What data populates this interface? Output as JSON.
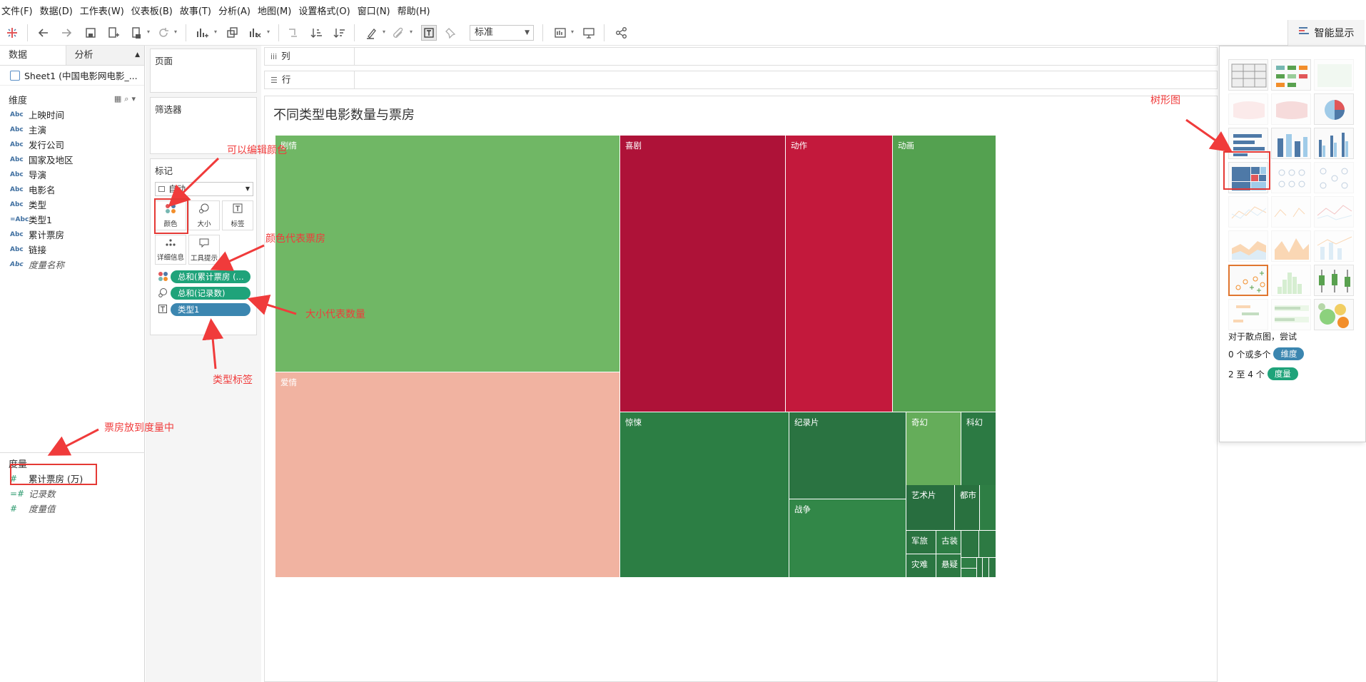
{
  "menubar": {
    "items": [
      "文件(F)",
      "数据(D)",
      "工作表(W)",
      "仪表板(B)",
      "故事(T)",
      "分析(A)",
      "地图(M)",
      "设置格式(O)",
      "窗口(N)",
      "帮助(H)"
    ]
  },
  "toolbar": {
    "fit_value": "标准",
    "show_me_label": "智能显示",
    "icons": [
      "tableau-logo-icon",
      "undo-icon",
      "redo-icon",
      "save-icon",
      "new-datasource-icon",
      "pause-updates-icon",
      "refresh-icon",
      "new-worksheet-icon",
      "duplicate-icon",
      "clear-icon",
      "swap-icon",
      "sort-ascending-icon",
      "sort-descending-icon",
      "highlight-icon",
      "group-icon",
      "show-labels-icon",
      "pin-icon",
      "show-cards-icon",
      "presentation-icon",
      "share-icon"
    ]
  },
  "data_pane": {
    "tab_data": "数据",
    "tab_analysis": "分析",
    "datasource": "Sheet1 (中国电影网电影_...",
    "dimensions_header": "维度",
    "dimensions": [
      {
        "type": "Abc",
        "name": "上映时间"
      },
      {
        "type": "Abc",
        "name": "主演"
      },
      {
        "type": "Abc",
        "name": "发行公司"
      },
      {
        "type": "Abc",
        "name": "国家及地区"
      },
      {
        "type": "Abc",
        "name": "导演"
      },
      {
        "type": "Abc",
        "name": "电影名"
      },
      {
        "type": "Abc",
        "name": "类型"
      },
      {
        "type": "=Abc",
        "name": "类型1"
      },
      {
        "type": "Abc",
        "name": "累计票房"
      },
      {
        "type": "Abc",
        "name": "链接"
      },
      {
        "type": "Abc",
        "name": "度量名称"
      }
    ],
    "measures_header": "度量",
    "measures": [
      {
        "type": "#",
        "name": "累计票房 (万)"
      },
      {
        "type": "=#",
        "name": "记录数"
      },
      {
        "type": "#",
        "name": "度量值"
      }
    ]
  },
  "shelves": {
    "pages_title": "页面",
    "filters_title": "筛选器",
    "marks_title": "标记",
    "marks_type": "自动",
    "mark_buttons": [
      "颜色",
      "大小",
      "标签",
      "详细信息",
      "工具提示"
    ],
    "pills": [
      {
        "label": "总和(累计票房 (...",
        "color": "#1fa37a"
      },
      {
        "label": "总和(记录数)",
        "color": "#1fa37a"
      },
      {
        "label": "类型1",
        "color": "#3b86b0"
      }
    ],
    "columns_label": "列",
    "rows_label": "行"
  },
  "view": {
    "title": "不同类型电影数量与票房"
  },
  "chart_data": {
    "type": "treemap",
    "title": "不同类型电影数量与票房",
    "size_measure": "总和(记录数)",
    "color_measure": "总和(累计票房 (万))",
    "label_dimension": "类型1",
    "tiles": [
      {
        "label": "剧情",
        "color": "#70b765"
      },
      {
        "label": "爱情",
        "color": "#f1b3a1"
      },
      {
        "label": "喜剧",
        "color": "#ae1238"
      },
      {
        "label": "动作",
        "color": "#c3193c"
      },
      {
        "label": "动画",
        "color": "#54a150"
      },
      {
        "label": "惊悚",
        "color": "#2c7e44"
      },
      {
        "label": "纪录片",
        "color": "#2a7341"
      },
      {
        "label": "奇幻",
        "color": "#65ad5a"
      },
      {
        "label": "科幻",
        "color": "#2c7a43"
      },
      {
        "label": "战争",
        "color": "#328748"
      },
      {
        "label": "艺术片",
        "color": "#286e3f"
      },
      {
        "label": "都市",
        "color": "#29713f"
      },
      {
        "label": "",
        "color": "#2e7e44"
      },
      {
        "label": "军旅",
        "color": "#2a7340"
      },
      {
        "label": "古装",
        "color": "#2d7d44"
      },
      {
        "label": "",
        "color": "#2b7541"
      },
      {
        "label": "",
        "color": "#2d7a43"
      },
      {
        "label": "灾难",
        "color": "#2b7642"
      },
      {
        "label": "悬疑",
        "color": "#2c7842"
      },
      {
        "label": "",
        "color": "#2e7e45"
      },
      {
        "label": "",
        "color": "#2b7541"
      },
      {
        "label": "",
        "color": "#2d7a44"
      },
      {
        "label": "",
        "color": "#2c7842"
      },
      {
        "label": "",
        "color": "#2e7f46"
      }
    ]
  },
  "show_me": {
    "hint": "对于散点图，尝试",
    "line1_prefix": "0 个或多个",
    "line1_pill": "维度",
    "line2_prefix": "2 至 4 个",
    "line2_pill": "度量",
    "pill_dimension_color": "#3b86b0",
    "pill_measure_color": "#1fa37a",
    "selected_chart": "treemap",
    "highlighted_chart": "scatter-plot"
  },
  "annotations": {
    "edit_color": "可以编辑颜色",
    "color_means": "颜色代表票房",
    "size_means": "大小代表数量",
    "type_label": "类型标签",
    "box_office_measure": "票房放到度量中",
    "treemap": "树形图",
    "color": "#f03b3b"
  }
}
